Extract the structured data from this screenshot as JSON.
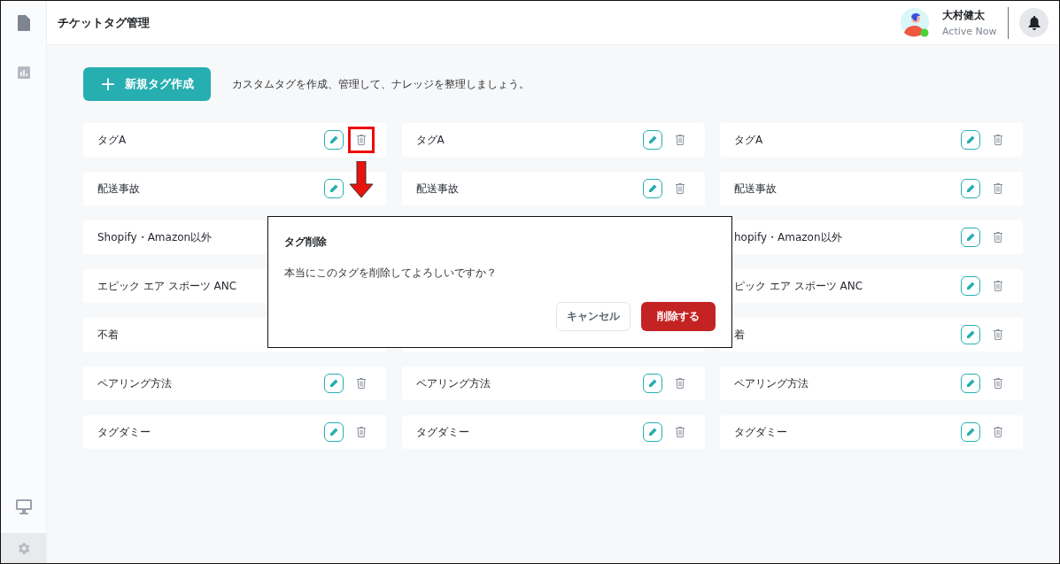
{
  "header": {
    "title": "チケットタグ管理",
    "user": {
      "name": "大村健太",
      "status": "Active Now"
    }
  },
  "toolbar": {
    "create_button": "新規タグ作成",
    "create_icon": "+",
    "description": "カスタムタグを作成、管理して、ナレッジを整理しましょう。"
  },
  "tag_rows": [
    {
      "cards": [
        {
          "kind": "tag",
          "label": "タグA",
          "actions": [
            {
              "kind": "edit"
            },
            {
              "kind": "delete",
              "highlighted": true
            }
          ]
        },
        {
          "kind": "tag",
          "label": "タグA",
          "actions": [
            {
              "kind": "edit"
            },
            {
              "kind": "delete",
              "highlighted": false
            }
          ]
        },
        {
          "kind": "tag",
          "label": "タグA",
          "actions": [
            {
              "kind": "edit"
            },
            {
              "kind": "delete",
              "highlighted": false
            }
          ]
        }
      ]
    },
    {
      "cards": [
        {
          "kind": "tag",
          "label": "配送事故",
          "actions": [
            {
              "kind": "edit"
            }
          ]
        },
        {
          "kind": "tag",
          "label": "配送事故",
          "actions": [
            {
              "kind": "edit"
            },
            {
              "kind": "delete",
              "highlighted": false
            }
          ]
        },
        {
          "kind": "tag",
          "label": "配送事故",
          "actions": [
            {
              "kind": "edit"
            },
            {
              "kind": "delete",
              "highlighted": false
            }
          ]
        }
      ]
    },
    {
      "cards": [
        {
          "kind": "tag",
          "label": "Shopify・Amazon以外"
        },
        {
          "kind": "covered"
        },
        {
          "kind": "tag",
          "label": "hopify・Amazon以外",
          "actions": [
            {
              "kind": "edit"
            },
            {
              "kind": "delete",
              "highlighted": false
            }
          ]
        }
      ]
    },
    {
      "cards": [
        {
          "kind": "tag",
          "label": "エピック エア スポーツ ANC"
        },
        {
          "kind": "covered"
        },
        {
          "kind": "tag",
          "label": "ピック エア スポーツ ANC",
          "actions": [
            {
              "kind": "edit"
            },
            {
              "kind": "delete",
              "highlighted": false
            }
          ]
        }
      ]
    },
    {
      "cards": [
        {
          "kind": "tag",
          "label": "不着"
        },
        {
          "kind": "covered"
        },
        {
          "kind": "tag",
          "label": "着",
          "actions": [
            {
              "kind": "edit"
            },
            {
              "kind": "delete",
              "highlighted": false
            }
          ]
        }
      ]
    },
    {
      "cards": [
        {
          "kind": "tag",
          "label": "ペアリング方法",
          "actions": [
            {
              "kind": "edit"
            },
            {
              "kind": "delete",
              "highlighted": false
            }
          ]
        },
        {
          "kind": "tag",
          "label": "ペアリング方法",
          "actions": [
            {
              "kind": "edit"
            },
            {
              "kind": "delete",
              "highlighted": false
            }
          ]
        },
        {
          "kind": "tag",
          "label": "ペアリング方法",
          "actions": [
            {
              "kind": "edit"
            },
            {
              "kind": "delete",
              "highlighted": false
            }
          ]
        }
      ]
    },
    {
      "cards": [
        {
          "kind": "tag",
          "label": "タグダミー",
          "actions": [
            {
              "kind": "edit"
            },
            {
              "kind": "delete",
              "highlighted": false
            }
          ]
        },
        {
          "kind": "tag",
          "label": "タグダミー",
          "actions": [
            {
              "kind": "edit"
            },
            {
              "kind": "delete",
              "highlighted": false
            }
          ]
        },
        {
          "kind": "tag",
          "label": "タグダミー",
          "actions": [
            {
              "kind": "edit"
            },
            {
              "kind": "delete",
              "highlighted": false
            }
          ]
        }
      ]
    }
  ],
  "dialog": {
    "title": "タグ削除",
    "message": "本当にこのタグを削除してよろしいですか？",
    "cancel_button": "キャンセル",
    "confirm_button": "削除する"
  }
}
